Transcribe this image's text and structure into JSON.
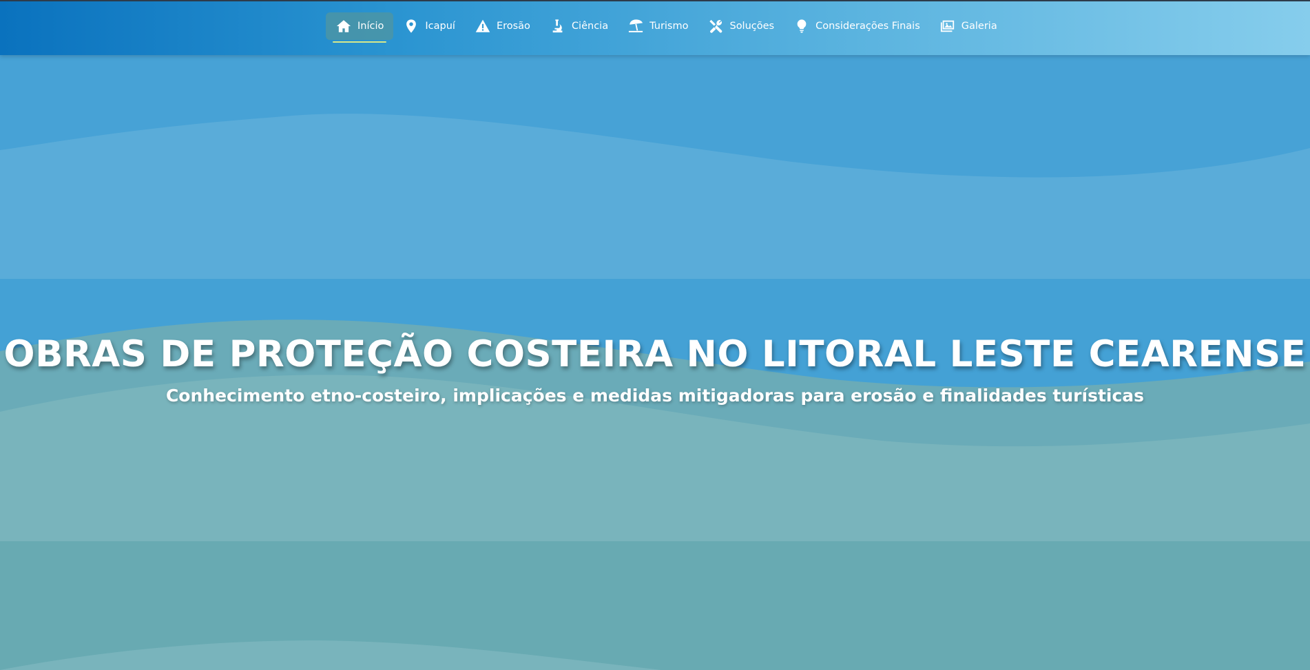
{
  "nav": {
    "items": [
      {
        "label": "Início",
        "icon": "home-icon",
        "active": true
      },
      {
        "label": "Icapuí",
        "icon": "map-pin-icon",
        "active": false
      },
      {
        "label": "Erosão",
        "icon": "warning-icon",
        "active": false
      },
      {
        "label": "Ciência",
        "icon": "microscope-icon",
        "active": false
      },
      {
        "label": "Turismo",
        "icon": "umbrella-beach-icon",
        "active": false
      },
      {
        "label": "Soluções",
        "icon": "tools-icon",
        "active": false
      },
      {
        "label": "Considerações Finais",
        "icon": "lightbulb-icon",
        "active": false
      },
      {
        "label": "Galeria",
        "icon": "images-icon",
        "active": false
      }
    ]
  },
  "hero": {
    "title": "OBRAS DE PROTEÇÃO COSTEIRA NO LITORAL LESTE CEARENSE",
    "subtitle": "Conhecimento etno-costeiro, implicações e medidas mitigadoras para erosão e finalidades turísticas"
  },
  "colors": {
    "nav_gradient_start": "#0a72be",
    "nav_gradient_end": "#86cdec",
    "active_underline": "#d8e98a",
    "wave_light_blue": "#5aacd9",
    "wave_teal": "#6aa9b4"
  }
}
